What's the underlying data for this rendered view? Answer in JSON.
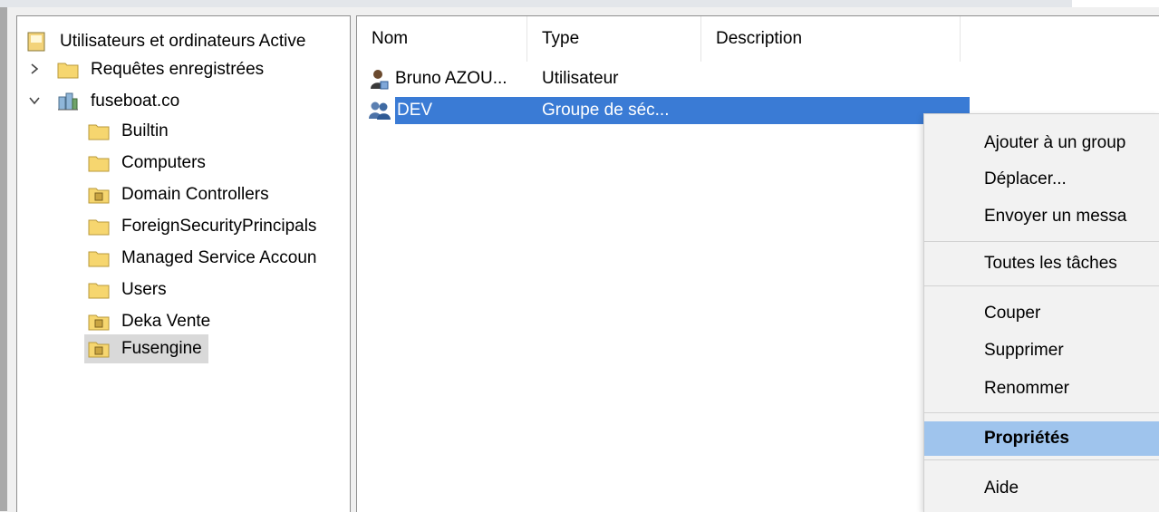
{
  "tree": {
    "root": "Utilisateurs et ordinateurs Active",
    "items": [
      {
        "label": "Requêtes enregistrées"
      },
      {
        "label": "fuseboat.co"
      },
      {
        "label": "Builtin"
      },
      {
        "label": "Computers"
      },
      {
        "label": "Domain Controllers"
      },
      {
        "label": "ForeignSecurityPrincipals"
      },
      {
        "label": "Managed Service Accoun"
      },
      {
        "label": "Users"
      },
      {
        "label": "Deka Vente"
      },
      {
        "label": "Fusengine"
      }
    ]
  },
  "list": {
    "columns": [
      "Nom",
      "Type",
      "Description"
    ],
    "rows": [
      {
        "name": "Bruno AZOU...",
        "type": "Utilisateur",
        "description": "",
        "icon": "user-icon"
      },
      {
        "name": "DEV",
        "type": "Groupe de séc...",
        "description": "",
        "icon": "group-icon"
      }
    ]
  },
  "context_menu": {
    "items": [
      {
        "label": "Ajouter à un group"
      },
      {
        "label": "Déplacer..."
      },
      {
        "label": "Envoyer un messa"
      },
      {
        "label": "Toutes les tâches"
      },
      {
        "label": "Couper"
      },
      {
        "label": "Supprimer"
      },
      {
        "label": "Renommer"
      },
      {
        "label": "Propriétés"
      },
      {
        "label": "Aide"
      }
    ]
  },
  "colors": {
    "selection_blue": "#3a7bd5",
    "menu_highlight": "#9fc4ed",
    "folder_yellow": "#f6d66f"
  }
}
